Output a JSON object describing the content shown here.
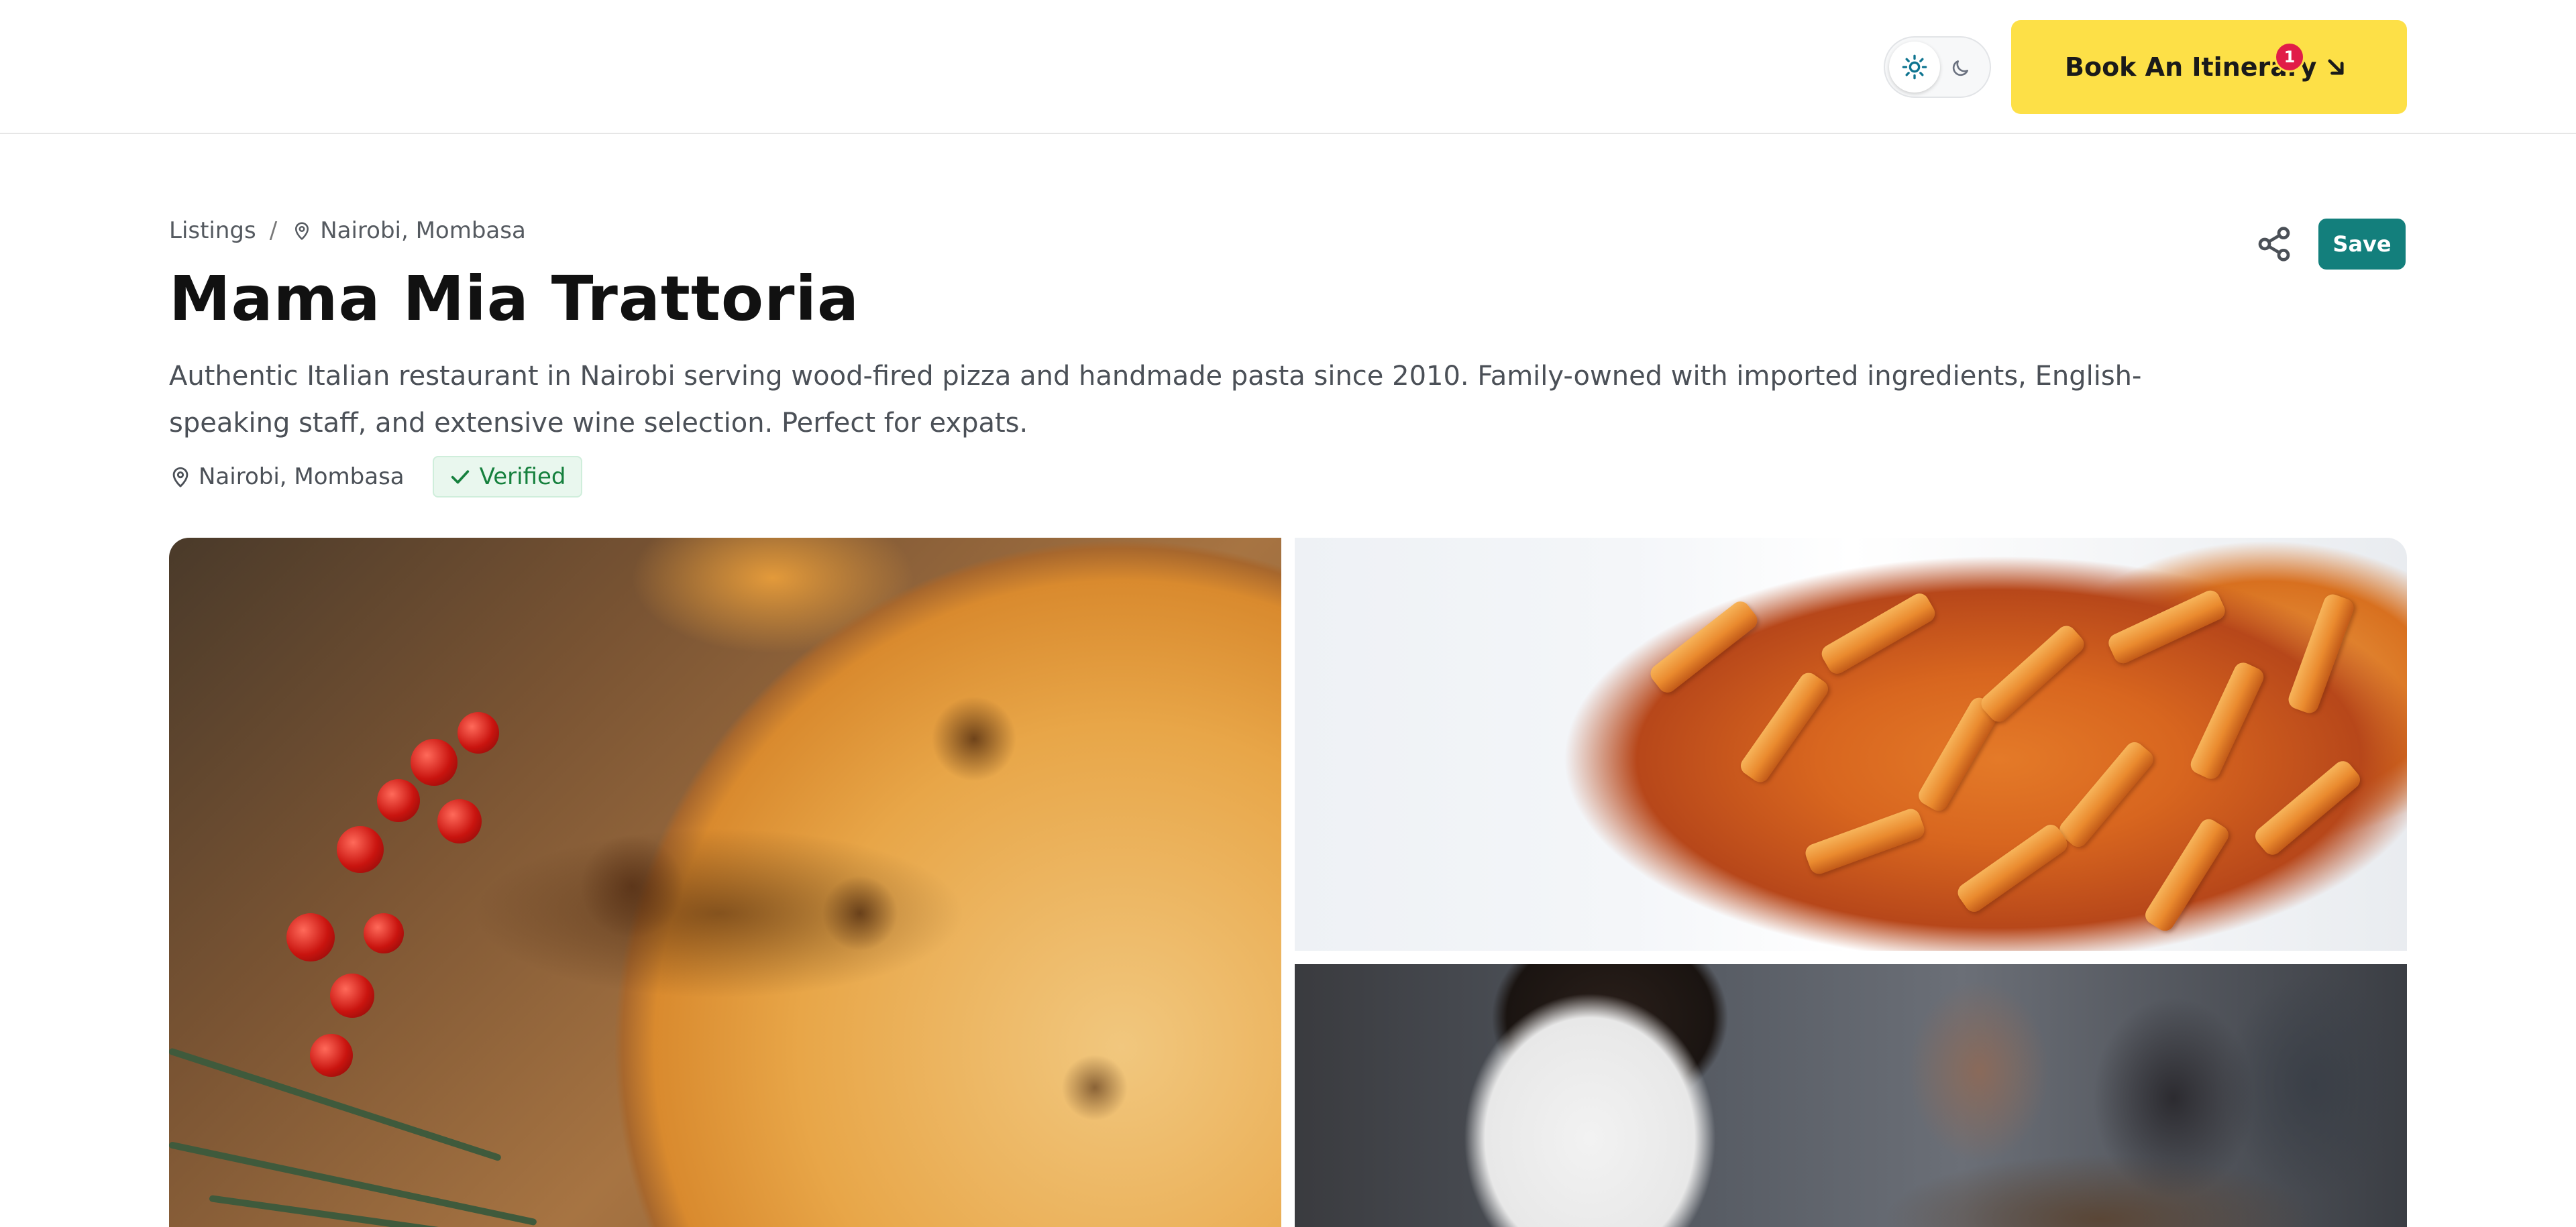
{
  "header": {
    "theme_toggle": {
      "active": "light",
      "light_icon": "sun-icon",
      "dark_icon": "moon-icon"
    },
    "book_button": {
      "label": "Book An Itinerary",
      "badge_count": "1",
      "icon": "arrow-down-right-icon",
      "color": "#fde047"
    }
  },
  "breadcrumb": {
    "root": "Listings",
    "separator": "/",
    "location": "Nairobi, Mombasa",
    "location_icon": "map-pin-icon"
  },
  "actions": {
    "share_icon": "share-icon",
    "save_label": "Save",
    "save_color": "#137f7c"
  },
  "listing": {
    "title": "Mama Mia Trattoria",
    "description": "Authentic Italian restaurant in Nairobi serving wood-fired pizza and handmade pasta since 2010. Family-owned with imported ingredients, English-speaking staff, and extensive wine selection. Perfect for expats.",
    "location": "Nairobi, Mombasa",
    "verified_label": "Verified",
    "verified_color": "#15803d"
  },
  "gallery": {
    "photos": [
      {
        "subject": "pizza"
      },
      {
        "subject": "penne pasta"
      },
      {
        "subject": "diners"
      }
    ]
  }
}
